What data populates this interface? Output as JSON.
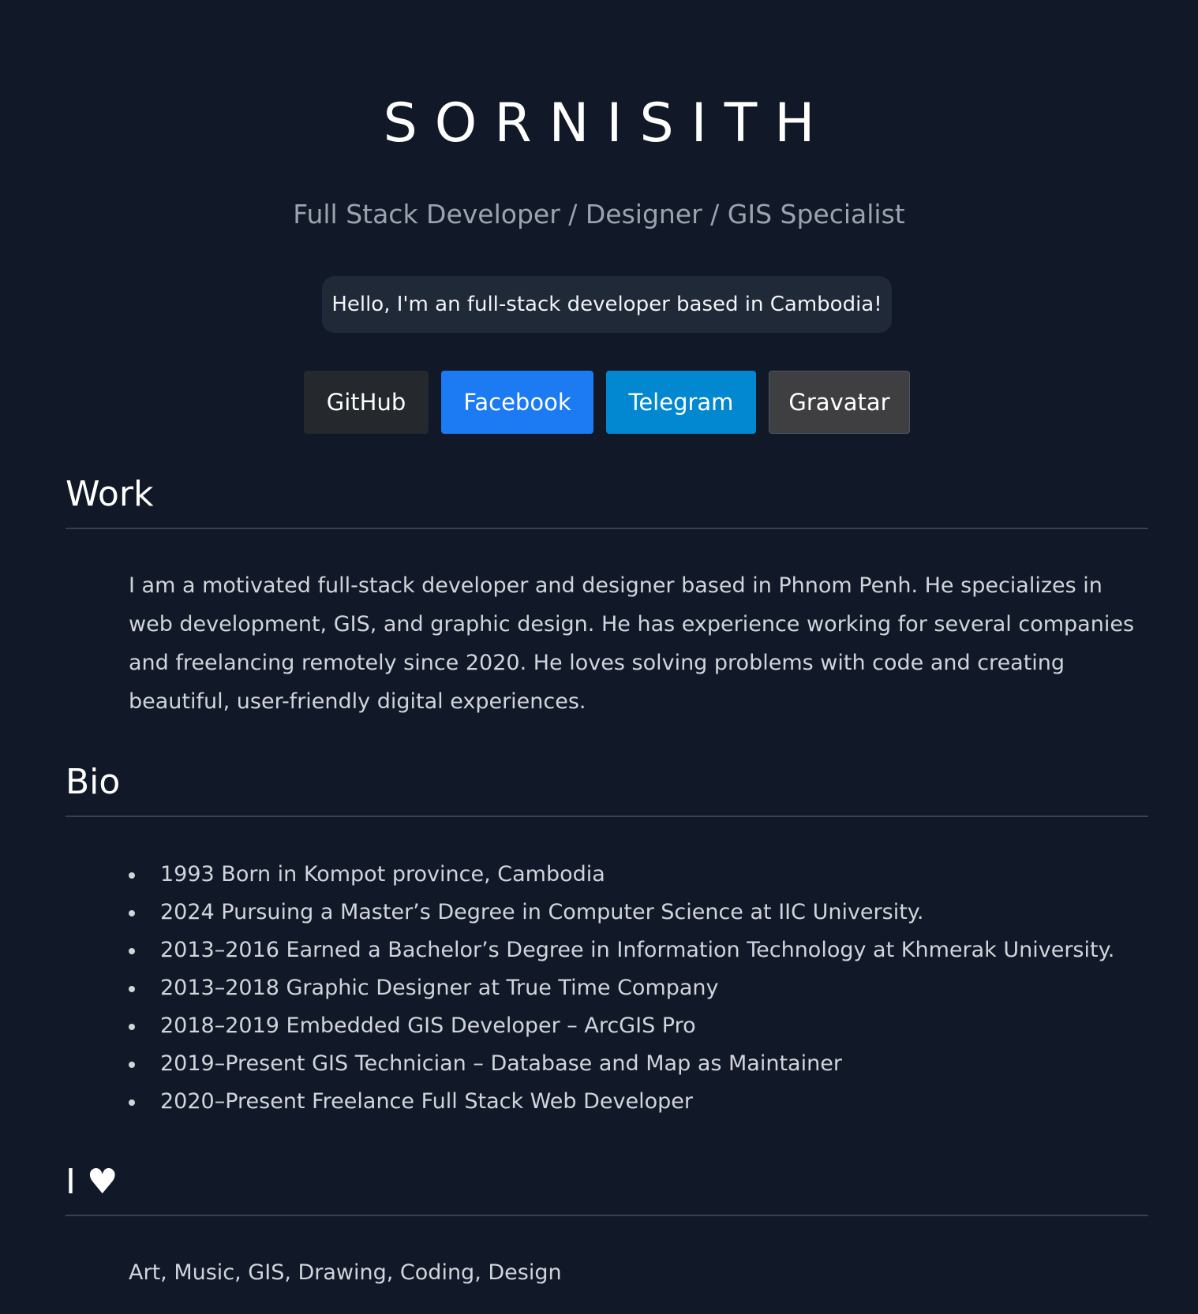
{
  "header": {
    "name": "SORNISITH",
    "tagline": "Full Stack Developer / Designer / GIS Specialist",
    "greeting": "Hello, I'm an full-stack developer based in Cambodia!"
  },
  "links": {
    "github": "GitHub",
    "facebook": "Facebook",
    "telegram": "Telegram",
    "gravatar": "Gravatar"
  },
  "work": {
    "title": "Work",
    "text": "I am a motivated full-stack developer and designer based in Phnom Penh. He specializes in web development, GIS, and graphic design. He has experience working for several companies and freelancing remotely since 2020. He loves solving problems with code and creating beautiful, user-friendly digital experiences."
  },
  "bio": {
    "title": "Bio",
    "items": [
      "1993 Born in Kompot province, Cambodia",
      "2024 Pursuing a Master’s Degree in Computer Science at IIC University.",
      "2013–2016 Earned a Bachelor’s Degree in Information Technology at Khmerak University.",
      "2013–2018 Graphic Designer at True Time Company",
      "2018–2019 Embedded GIS Developer – ArcGIS Pro",
      "2019–Present GIS Technician – Database and Map as Maintainer",
      "2020–Present Freelance Full Stack Web Developer"
    ]
  },
  "love": {
    "title": "I ♥",
    "text": "Art, Music, GIS, Drawing, Coding, Design"
  },
  "colors": {
    "background": "#111827",
    "facebook": "#1c7af2",
    "telegram": "#0288d1",
    "github": "#25282d",
    "gravatar": "#3f3f42"
  }
}
